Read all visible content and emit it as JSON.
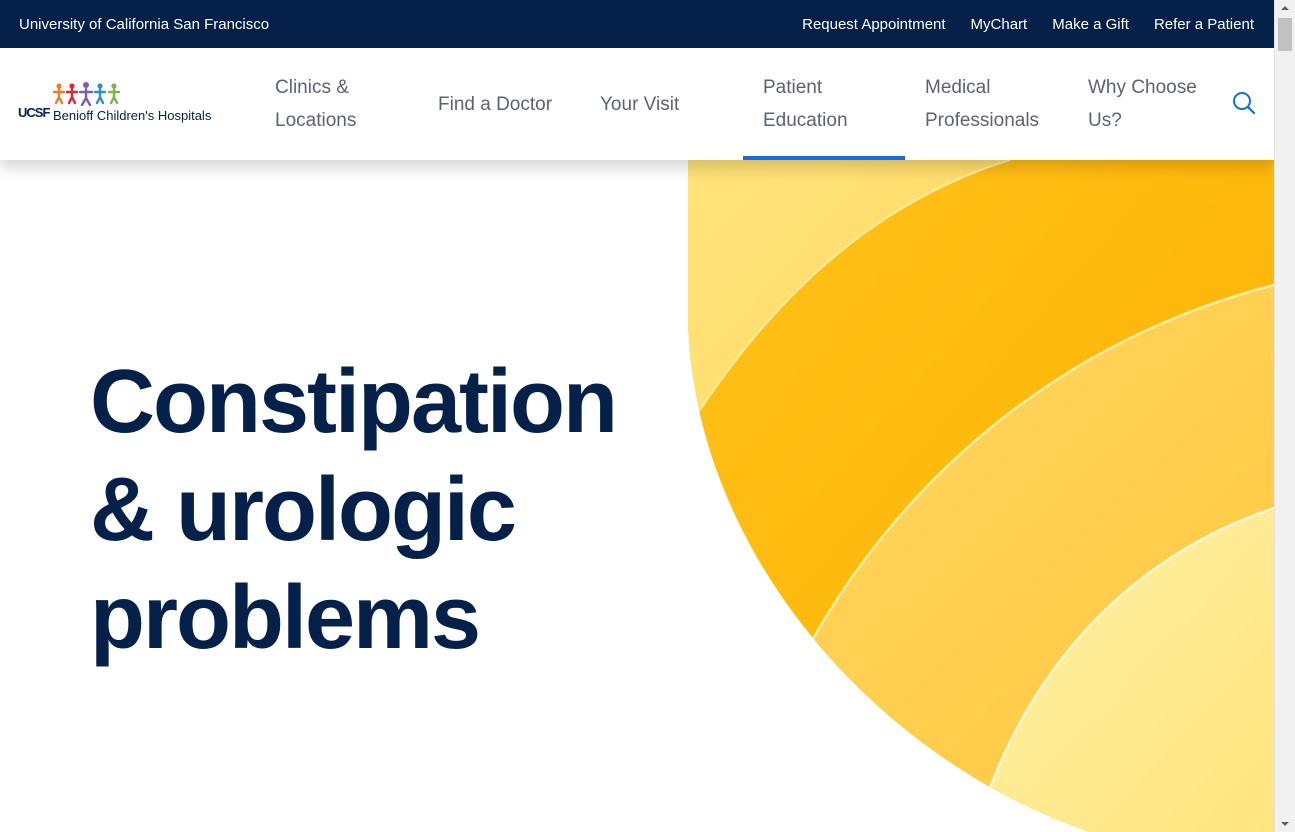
{
  "topbar": {
    "university": "University of California San Francisco",
    "links": [
      "Request Appointment",
      "MyChart",
      "Make a Gift",
      "Refer a Patient"
    ]
  },
  "logo": {
    "mark": "UCSF",
    "name": "Benioff Children's Hospitals"
  },
  "nav": {
    "items": [
      {
        "label": "Clinics & Locations",
        "active": false
      },
      {
        "label": "Find a Doctor",
        "active": false
      },
      {
        "label": "Your Visit",
        "active": false
      },
      {
        "label": "Patient Education",
        "active": true
      },
      {
        "label": "Medical Professionals",
        "active": false
      },
      {
        "label": "Why Choose Us?",
        "active": false
      }
    ],
    "search_icon": "search-icon"
  },
  "hero": {
    "title": "Constipation & urologic problems"
  },
  "colors": {
    "navy": "#052049",
    "accent_blue": "#0f6ee1",
    "nav_text": "#5b6278",
    "hero_yellow": "#ffc72c"
  }
}
